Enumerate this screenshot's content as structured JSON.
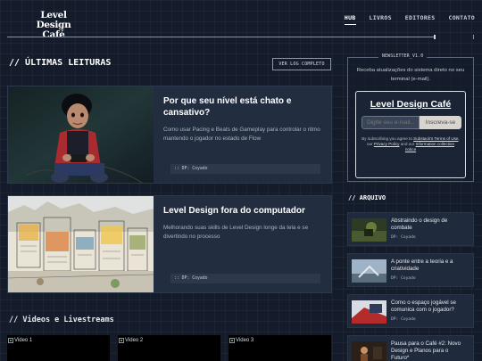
{
  "site": {
    "logo_line1": "Level Design",
    "logo_line2": "Café"
  },
  "nav": [
    {
      "label": "HUB",
      "active": true
    },
    {
      "label": "LIVROS",
      "active": false
    },
    {
      "label": "EDITORES",
      "active": false
    },
    {
      "label": "CONTATO",
      "active": false
    }
  ],
  "latest": {
    "title": "// ÚLTIMAS LEITURAS",
    "log_button": "VER LOG COMPLETO",
    "articles": [
      {
        "title": "Por que seu nível está chato e cansativo?",
        "excerpt": "Como usar Pacing e Beats de Gameplay para controlar o ritmo mantendo o jogador no estado de Flow",
        "author": ":: DP: Coyado",
        "image": "boy-playing-videogame-illustration"
      },
      {
        "title": "Level Design fora do computador",
        "excerpt": "Melhorando suas skills de Level Design longe da tela e se divertindo no processo",
        "author": ":: DP: Coyado",
        "image": "watercolor-city-sketch"
      }
    ]
  },
  "videos": {
    "title": "// Videos e Livestreams",
    "items": [
      "Video 1",
      "Video 2",
      "Video 3"
    ]
  },
  "newsletter": {
    "label": "NEWSLETTER_V1.0",
    "description": "Receba atualizações do sistema direto no seu terminal (e-mail).",
    "widget_title": "Level Design Café",
    "email_placeholder": "Digite seu e-mail...",
    "subscribe_label": "Inscreva-se",
    "terms_prefix": "By subscribing you agree to ",
    "terms_link": "Substack's Terms of Use",
    "terms_mid": ", our ",
    "privacy_link": "Privacy Policy",
    "terms_and": " and our ",
    "info_link": "Information collection notice"
  },
  "archive": {
    "title": "// ARQUIVO",
    "items": [
      {
        "title": "Abstraindo o design de combate",
        "author": "DP: Coyado"
      },
      {
        "title": "A ponte entre a teoria e a criatividade",
        "author": "DP: Coyado"
      },
      {
        "title": "Como o espaço jogável se comunica com o jogador?",
        "author": "DP: Coyado"
      },
      {
        "title": "Pausa para o Café #2: Novo Design e Planos para o Futuro*",
        "author": ""
      }
    ]
  },
  "colors": {
    "background": "#141c2b",
    "card": "#222d40",
    "accent_text": "#ffffff"
  }
}
